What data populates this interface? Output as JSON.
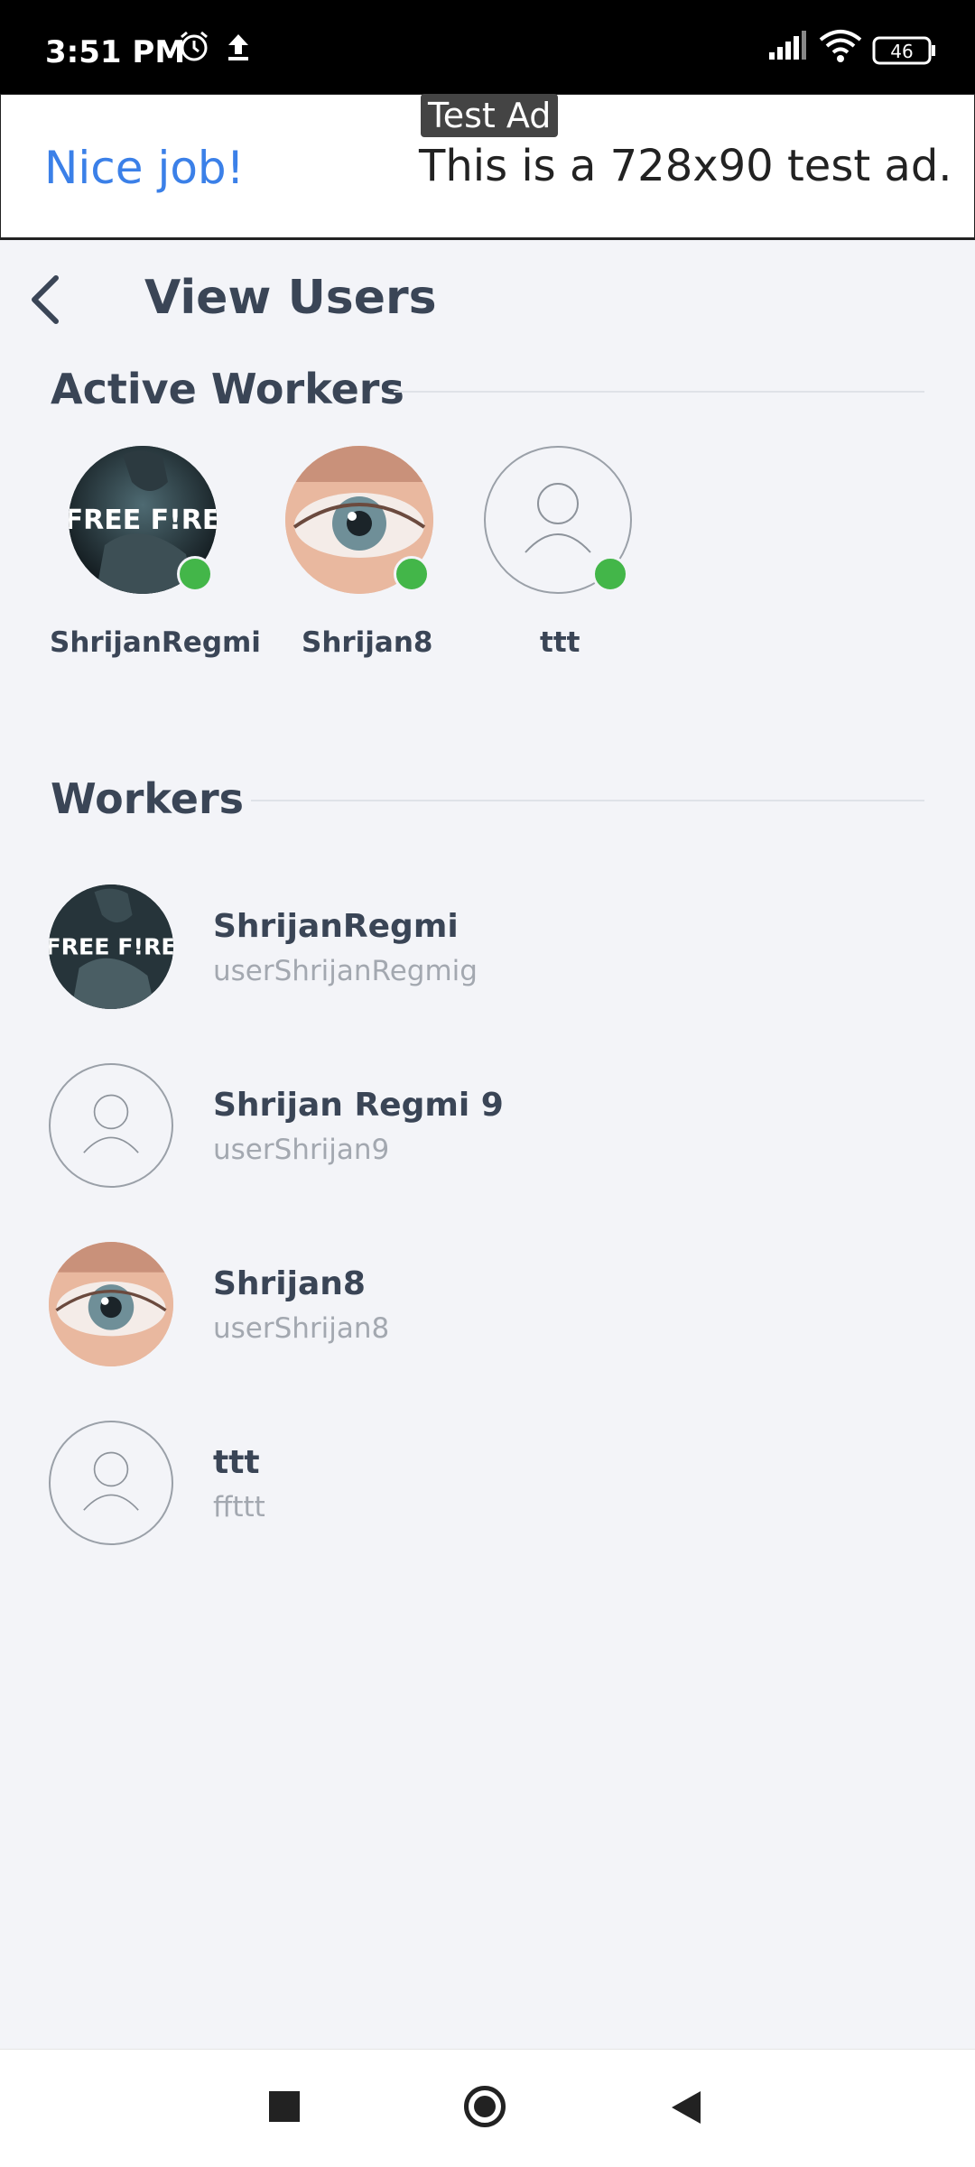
{
  "status_bar": {
    "time": "3:51 PM",
    "battery": "46",
    "icons": [
      "alarm-icon",
      "upload-icon",
      "signal-icon",
      "wifi-icon",
      "battery-icon"
    ]
  },
  "ad": {
    "headline": "Nice job!",
    "badge": "Test Ad",
    "text": "This is a 728x90 test ad."
  },
  "header": {
    "title": "View Users"
  },
  "active_workers": {
    "title": "Active Workers",
    "items": [
      {
        "name": "ShrijanRegmi",
        "avatar": "free-fire-image",
        "online": true
      },
      {
        "name": "Shrijan8",
        "avatar": "eye-image",
        "online": true
      },
      {
        "name": "ttt",
        "avatar": "default-user-icon",
        "online": true
      }
    ]
  },
  "workers": {
    "title": "Workers",
    "items": [
      {
        "name": "ShrijanRegmi",
        "username": "userShrijanRegmig",
        "avatar": "free-fire-image"
      },
      {
        "name": "Shrijan Regmi 9",
        "username": "userShrijan9",
        "avatar": "default-user-icon"
      },
      {
        "name": "Shrijan8",
        "username": "userShrijan8",
        "avatar": "eye-image"
      },
      {
        "name": "ttt",
        "username": "ffttt",
        "avatar": "default-user-icon"
      }
    ]
  },
  "colors": {
    "background": "#f3f4f8",
    "text": "#3a4556",
    "muted": "#a3a8b0",
    "online": "#43b649",
    "ad_link": "#3b80e8"
  },
  "nav_bar": {
    "buttons": [
      "recents-icon",
      "home-icon",
      "back-icon"
    ]
  }
}
